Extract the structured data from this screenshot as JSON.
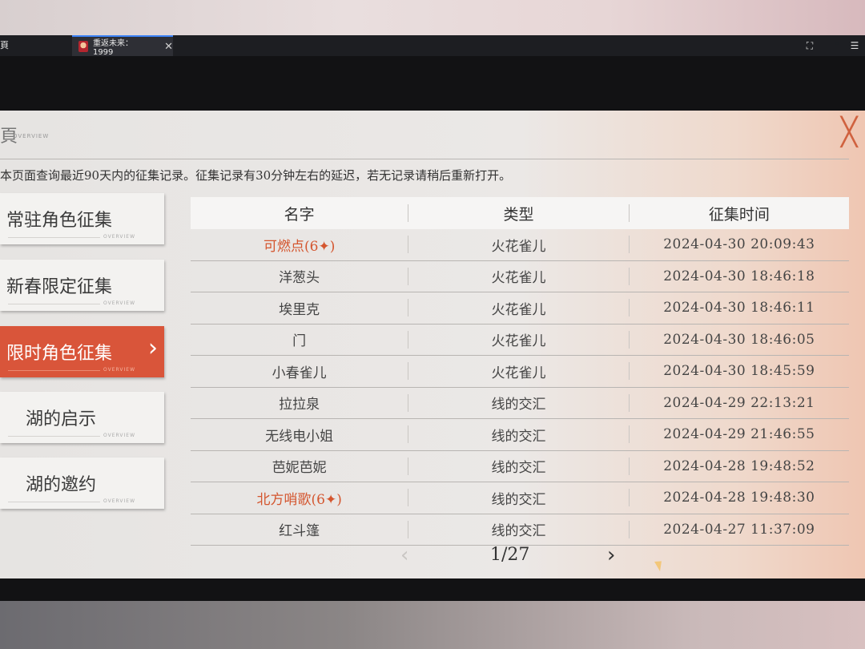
{
  "titlebar": {
    "left_label": "頁",
    "tab_title": "重返未来：1999",
    "close_label": "✕"
  },
  "panel": {
    "title": "頁",
    "subtitle": "OVERVIEW",
    "notice": "本页面查询最近90天内的征集记录。征集记录有30分钟左右的延迟，若无记录请稍后重新打开。",
    "close_icon": "close-icon"
  },
  "sidebar": {
    "items": [
      {
        "label": "常驻角色征集",
        "deco": "OVERVIEW",
        "active": false
      },
      {
        "label": "新春限定征集",
        "deco": "OVERVIEW",
        "active": false
      },
      {
        "label": "限时角色征集",
        "deco": "OVERVIEW",
        "active": true
      },
      {
        "label": "湖的启示",
        "deco": "OVERVIEW",
        "active": false
      },
      {
        "label": "湖的邀约",
        "deco": "OVERVIEW",
        "active": false
      }
    ]
  },
  "table": {
    "headers": {
      "name": "名字",
      "type": "类型",
      "time": "征集时间"
    },
    "rows": [
      {
        "name": "可燃点(6✦)",
        "type": "火花雀儿",
        "time": "2024-04-30 20:09:43",
        "rare": true
      },
      {
        "name": "洋葱头",
        "type": "火花雀儿",
        "time": "2024-04-30 18:46:18",
        "rare": false
      },
      {
        "name": "埃里克",
        "type": "火花雀儿",
        "time": "2024-04-30 18:46:11",
        "rare": false
      },
      {
        "name": "门",
        "type": "火花雀儿",
        "time": "2024-04-30 18:46:05",
        "rare": false
      },
      {
        "name": "小春雀儿",
        "type": "火花雀儿",
        "time": "2024-04-30 18:45:59",
        "rare": false
      },
      {
        "name": "拉拉泉",
        "type": "线的交汇",
        "time": "2024-04-29 22:13:21",
        "rare": false
      },
      {
        "name": "无线电小姐",
        "type": "线的交汇",
        "time": "2024-04-29 21:46:55",
        "rare": false
      },
      {
        "name": "芭妮芭妮",
        "type": "线的交汇",
        "time": "2024-04-28 19:48:52",
        "rare": false
      },
      {
        "name": "北方哨歌(6✦)",
        "type": "线的交汇",
        "time": "2024-04-28 19:48:30",
        "rare": true
      },
      {
        "name": "红斗篷",
        "type": "线的交汇",
        "time": "2024-04-27 11:37:09",
        "rare": false
      }
    ]
  },
  "pager": {
    "current": "1/27",
    "prev": "‹",
    "next": "›"
  },
  "colors": {
    "accent": "#d9553a",
    "rare_text": "#d4562f"
  }
}
